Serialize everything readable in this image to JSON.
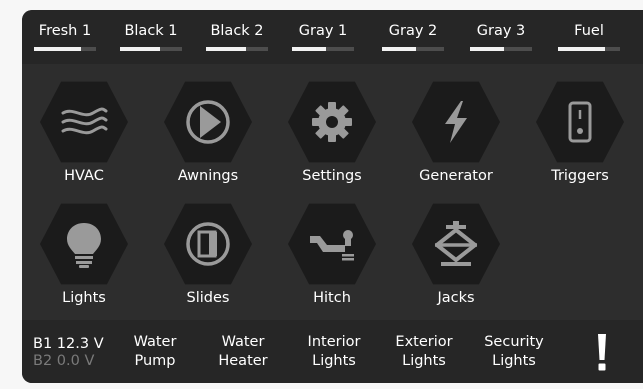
{
  "tanks": [
    {
      "label": "Fresh 1",
      "level": 0.75
    },
    {
      "label": "Black 1",
      "level": 0.65
    },
    {
      "label": "Black 2",
      "level": 0.65
    },
    {
      "label": "Gray 1",
      "level": 0.55
    },
    {
      "label": "Gray 2",
      "level": 0.55
    },
    {
      "label": "Gray 3",
      "level": 0.55
    },
    {
      "label": "Fuel",
      "level": 0.75
    }
  ],
  "tiles": [
    {
      "label": "HVAC",
      "icon": "hvac-icon"
    },
    {
      "label": "Awnings",
      "icon": "awning-icon"
    },
    {
      "label": "Settings",
      "icon": "gear-icon"
    },
    {
      "label": "Generator",
      "icon": "lightning-icon"
    },
    {
      "label": "Triggers",
      "icon": "switch-icon"
    },
    {
      "label": "Lights",
      "icon": "lightbulb-icon"
    },
    {
      "label": "Slides",
      "icon": "slide-icon"
    },
    {
      "label": "Hitch",
      "icon": "hitch-icon"
    },
    {
      "label": "Jacks",
      "icon": "jack-icon"
    }
  ],
  "battery": {
    "b1_label": "B1",
    "b1_value": "12.3 V",
    "b2_label": "B2",
    "b2_value": "0.0 V"
  },
  "bottom_buttons": [
    {
      "line1": "Water",
      "line2": "Pump"
    },
    {
      "line1": "Water",
      "line2": "Heater"
    },
    {
      "line1": "Interior",
      "line2": "Lights"
    },
    {
      "line1": "Exterior",
      "line2": "Lights"
    },
    {
      "line1": "Security",
      "line2": "Lights"
    }
  ],
  "alert_icon": "exclamation-icon",
  "colors": {
    "panel": "#2d2d2d",
    "bar": "#262626",
    "hex": "#1b1b1b",
    "icon": "#9a9a9a",
    "text": "#ffffff",
    "muted": "#7a7a7a"
  }
}
